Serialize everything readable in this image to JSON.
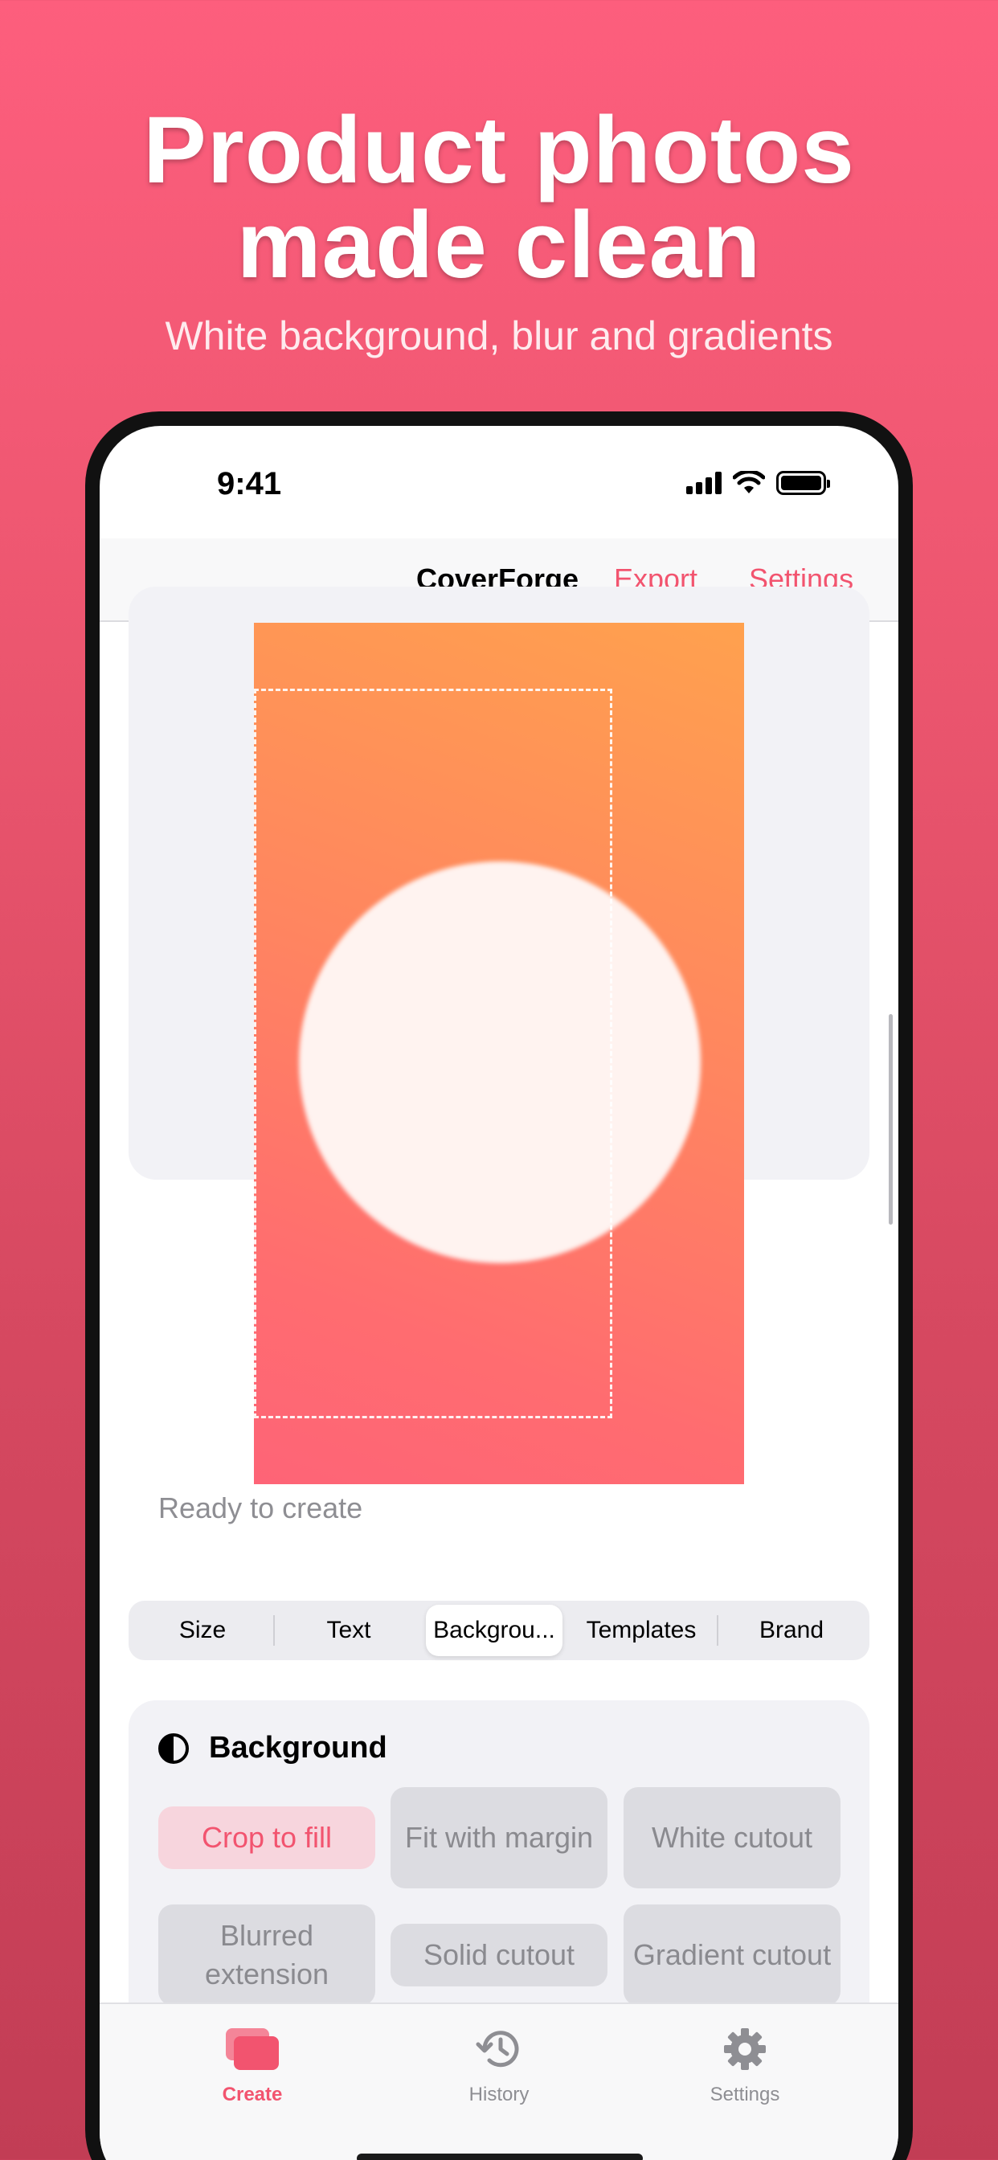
{
  "hero": {
    "title_line1": "Product photos",
    "title_line2": "made clean",
    "subtitle": "White background, blur and gradients"
  },
  "status_bar": {
    "time": "9:41"
  },
  "nav": {
    "title": "CoverForge",
    "export_label": "Export",
    "settings_label": "Settings"
  },
  "preview": {
    "status_text": "Ready to create"
  },
  "tabs_segmented": {
    "items": [
      "Size",
      "Text",
      "Backgrou...",
      "Templates",
      "Brand"
    ],
    "selected": "Backgrou..."
  },
  "background_section": {
    "heading": "Background",
    "options": [
      {
        "label": "Crop to fill",
        "active": true
      },
      {
        "label": "Fit with margin",
        "active": false
      },
      {
        "label": "White cutout",
        "active": false
      },
      {
        "label": "Blurred extension",
        "active": false
      },
      {
        "label": "Solid cutout",
        "active": false
      },
      {
        "label": "Gradient cutout",
        "active": false
      }
    ]
  },
  "tab_bar": {
    "items": [
      {
        "label": "Create",
        "icon": "cards-stack-icon",
        "active": true
      },
      {
        "label": "History",
        "icon": "history-clock-icon",
        "active": false
      },
      {
        "label": "Settings",
        "icon": "gear-icon",
        "active": false
      }
    ]
  },
  "colors": {
    "accent": "#f2546f",
    "background_top": "#fd5e7d",
    "background_bottom": "#c23d55"
  }
}
